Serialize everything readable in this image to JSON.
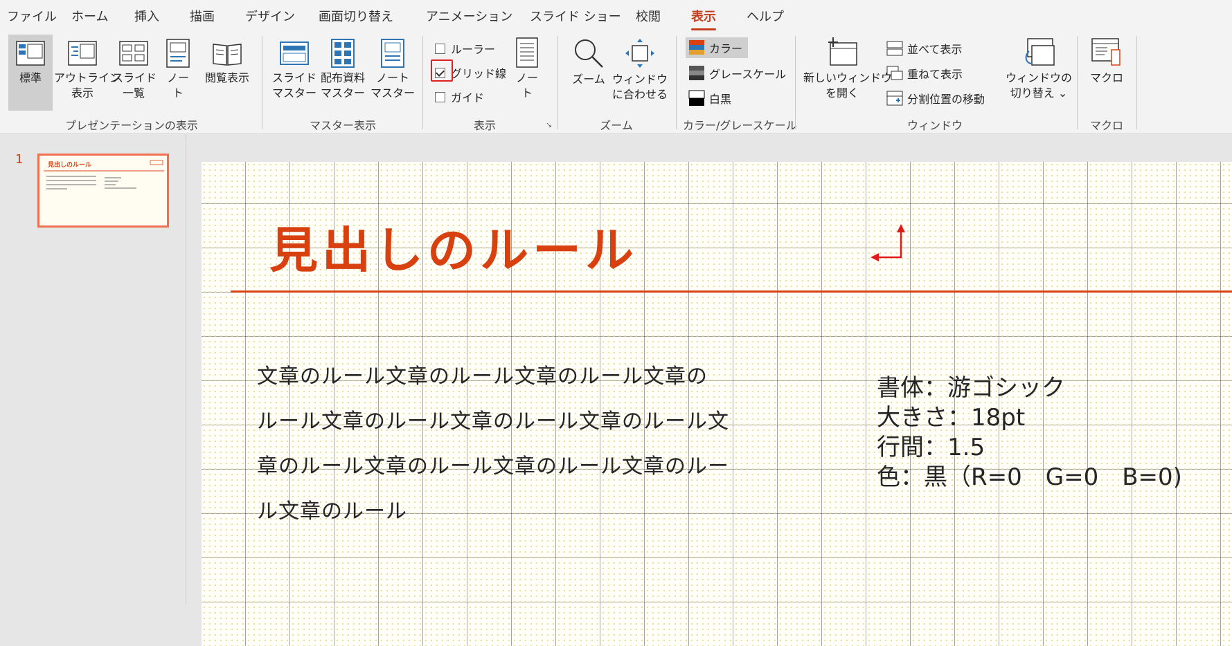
{
  "ribbon_tabs": [
    "ファイル",
    "ホーム",
    "挿入",
    "描画",
    "デザイン",
    "画面切り替え",
    "アニメーション",
    "スライド ショー",
    "校閲",
    "表示",
    "ヘルプ"
  ],
  "active_tab": "表示",
  "groups": {
    "presentation_view": {
      "label": "プレゼンテーションの表示",
      "normal": "標準",
      "outline_l1": "アウトライン",
      "outline_l2": "表示",
      "sorter_l1": "スライド",
      "sorter_l2": "一覧",
      "notes_l1": "ノー",
      "notes_l2": "ト",
      "reading": "閲覧表示"
    },
    "master_view": {
      "label": "マスター表示",
      "slide_master_l1": "スライド",
      "slide_master_l2": "マスター",
      "handout_master_l1": "配布資料",
      "handout_master_l2": "マスター",
      "notes_master_l1": "ノート",
      "notes_master_l2": "マスター"
    },
    "show": {
      "label": "表示",
      "ruler": "ルーラー",
      "gridlines": "グリッド線",
      "guides": "ガイド",
      "notes_l1": "ノー",
      "notes_l2": "ト"
    },
    "zoom": {
      "label": "ズーム",
      "zoom": "ズーム",
      "fit_l1": "ウィンドウ",
      "fit_l2": "に合わせる"
    },
    "color": {
      "label": "カラー/グレースケール",
      "color": "カラー",
      "grayscale": "グレースケール",
      "bw": "白黒"
    },
    "window": {
      "label": "ウィンドウ",
      "new_l1": "新しいウィンドウ",
      "new_l2": "を開く",
      "arrange": "並べて表示",
      "cascade": "重ねて表示",
      "move_split": "分割位置の移動",
      "switch_l1": "ウィンドウの",
      "switch_l2": "切り替え ⌄"
    },
    "macro": {
      "label": "マクロ",
      "macro": "マクロ"
    }
  },
  "checkbox_state": {
    "ruler": false,
    "gridlines": true,
    "guides": false
  },
  "slide_number": "1",
  "slide": {
    "title": "見出しのルール",
    "body_lines": [
      "文章のルール文章のルール文章のルール文章の",
      "ルール文章のルール文章のルール文章のルール文",
      "章のルール文章のルール文章のルール文章のルー",
      "ル文章のルール"
    ],
    "spec_lines": [
      "書体：游ゴシック",
      "大きさ：18pt",
      "行間：1.5",
      "色：黒（R=0　G=0　B=0)"
    ]
  },
  "colors": {
    "accent": "#d9400f",
    "active_tab": "#c43e1c",
    "highlight_box": "#dd2222",
    "arrow": "#e0191b"
  }
}
